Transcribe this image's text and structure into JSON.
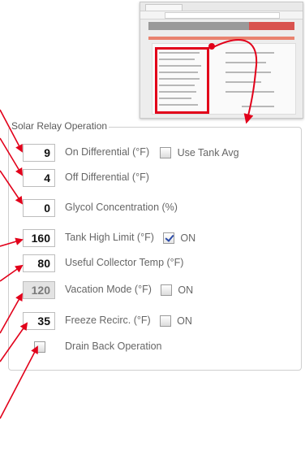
{
  "section_title": "Solar Relay Operation",
  "fields": [
    {
      "value": "9",
      "label": "On Differential (°F)",
      "checkbox": {
        "checked": false,
        "label": "Use Tank Avg"
      }
    },
    {
      "value": "4",
      "label": "Off Differential (°F)"
    },
    {
      "value": "0",
      "label": "Glycol Concentration (%)"
    },
    {
      "value": "160",
      "label": "Tank High Limit (°F)",
      "checkbox": {
        "checked": true,
        "label": "ON"
      }
    },
    {
      "value": "80",
      "label": "Useful Collector Temp (°F)"
    },
    {
      "value": "120",
      "label": "Vacation Mode (°F)",
      "disabled": true,
      "checkbox": {
        "checked": false,
        "label": "ON"
      }
    },
    {
      "value": "35",
      "label": "Freeze Recirc. (°F)",
      "checkbox": {
        "checked": false,
        "label": "ON"
      }
    }
  ],
  "drain_back": {
    "checked": false,
    "label": "Drain Back Operation"
  },
  "colors": {
    "accent": "#e2001a",
    "border": "#cfcfcf",
    "label": "#666666"
  }
}
